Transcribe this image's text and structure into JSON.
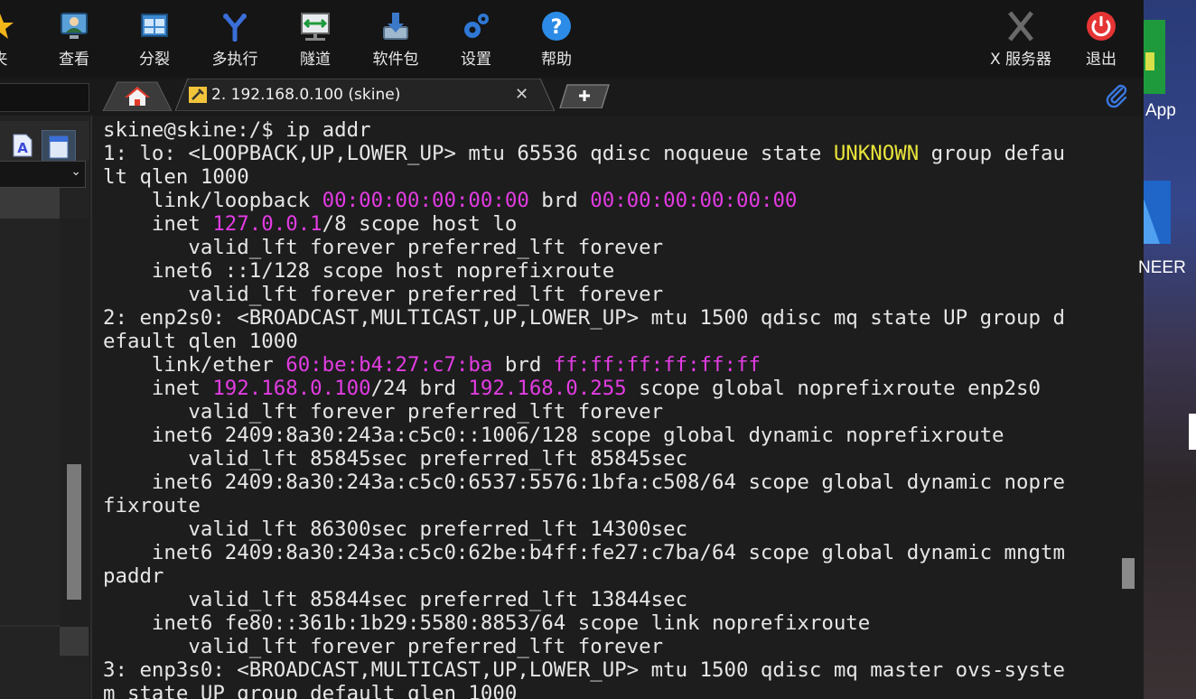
{
  "toolbar": {
    "buttons": [
      {
        "label": "夹",
        "icon": "star-folder-icon"
      },
      {
        "label": "查看",
        "icon": "monitor-user-icon"
      },
      {
        "label": "分裂",
        "icon": "split-window-icon"
      },
      {
        "label": "多执行",
        "icon": "multi-exec-fork-icon"
      },
      {
        "label": "隧道",
        "icon": "tunnel-network-icon"
      },
      {
        "label": "软件包",
        "icon": "package-download-icon"
      },
      {
        "label": "设置",
        "icon": "gears-icon"
      },
      {
        "label": "帮助",
        "icon": "help-question-icon"
      },
      {
        "label": "X 服务器",
        "icon": "x-server-icon"
      },
      {
        "label": "退出",
        "icon": "power-exit-icon"
      }
    ]
  },
  "tabs": {
    "home_icon": "home-icon",
    "session_label": "2. 192.168.0.100 (skine)",
    "session_icon": "wrench-terminal-icon",
    "close_glyph": "✕",
    "new_tab_glyph": "+",
    "attach_icon": "paperclip-icon"
  },
  "sidebar": {
    "select_chevron": "⌄"
  },
  "terminal": {
    "lines": [
      [
        {
          "t": "skine@skine:/$ ip addr"
        }
      ],
      [
        {
          "t": "1: lo: <LOOPBACK,UP,LOWER_UP> mtu 65536 qdisc noqueue state "
        },
        {
          "t": "UNKNOWN",
          "c": "yel"
        },
        {
          "t": " group defau"
        }
      ],
      [
        {
          "t": "lt qlen 1000"
        }
      ],
      [
        {
          "t": "    link/loopback "
        },
        {
          "t": "00:00:00:00:00:00",
          "c": "mag"
        },
        {
          "t": " brd "
        },
        {
          "t": "00:00:00:00:00:00",
          "c": "mag"
        }
      ],
      [
        {
          "t": "    inet "
        },
        {
          "t": "127.0.0.1",
          "c": "mag"
        },
        {
          "t": "/8 scope host lo"
        }
      ],
      [
        {
          "t": "       valid_lft forever preferred_lft forever"
        }
      ],
      [
        {
          "t": "    inet6 ::1/128 scope host noprefixroute"
        }
      ],
      [
        {
          "t": "       valid_lft forever preferred_lft forever"
        }
      ],
      [
        {
          "t": "2: enp2s0: <BROADCAST,MULTICAST,UP,LOWER_UP> mtu 1500 qdisc mq state UP group d"
        }
      ],
      [
        {
          "t": "efault qlen 1000"
        }
      ],
      [
        {
          "t": "    link/ether "
        },
        {
          "t": "60:be:b4:27:c7:ba",
          "c": "mag"
        },
        {
          "t": " brd "
        },
        {
          "t": "ff:ff:ff:ff:ff:ff",
          "c": "mag"
        }
      ],
      [
        {
          "t": "    inet "
        },
        {
          "t": "192.168.0.100",
          "c": "mag"
        },
        {
          "t": "/24 brd "
        },
        {
          "t": "192.168.0.255",
          "c": "mag"
        },
        {
          "t": " scope global noprefixroute enp2s0"
        }
      ],
      [
        {
          "t": "       valid_lft forever preferred_lft forever"
        }
      ],
      [
        {
          "t": "    inet6 2409:8a30:243a:c5c0::1006/128 scope global dynamic noprefixroute"
        }
      ],
      [
        {
          "t": "       valid_lft 85845sec preferred_lft 85845sec"
        }
      ],
      [
        {
          "t": "    inet6 2409:8a30:243a:c5c0:6537:5576:1bfa:c508/64 scope global dynamic nopre"
        }
      ],
      [
        {
          "t": "fixroute"
        }
      ],
      [
        {
          "t": "       valid_lft 86300sec preferred_lft 14300sec"
        }
      ],
      [
        {
          "t": "    inet6 2409:8a30:243a:c5c0:62be:b4ff:fe27:c7ba/64 scope global dynamic mngtm"
        }
      ],
      [
        {
          "t": "paddr"
        }
      ],
      [
        {
          "t": "       valid_lft 85844sec preferred_lft 13844sec"
        }
      ],
      [
        {
          "t": "    inet6 fe80::361b:1b29:5580:8853/64 scope link noprefixroute"
        }
      ],
      [
        {
          "t": "       valid_lft forever preferred_lft forever"
        }
      ],
      [
        {
          "t": "3: enp3s0: <BROADCAST,MULTICAST,UP,LOWER_UP> mtu 1500 qdisc mq master ovs-syste"
        }
      ],
      [
        {
          "t": "m state UP group default qlen 1000"
        }
      ]
    ]
  },
  "desktop": {
    "app_text": "App",
    "neer_text": "NEER"
  }
}
